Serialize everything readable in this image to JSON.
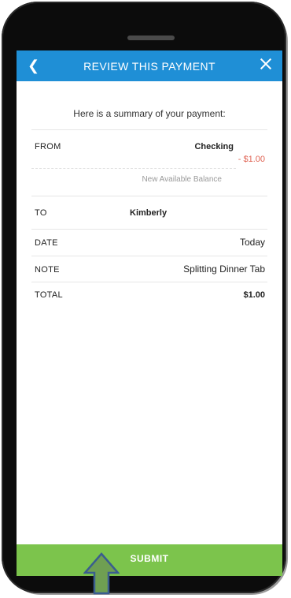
{
  "header": {
    "back_icon": "chevron-left-icon",
    "title": "REVIEW THIS PAYMENT",
    "close_icon": "close-icon"
  },
  "summary_text": "Here is a summary of your payment:",
  "rows": {
    "from": {
      "label": "FROM",
      "account": "Checking",
      "amount": "- $1.00",
      "balance_label": "New Available Balance"
    },
    "to": {
      "label": "TO",
      "value": "Kimberly"
    },
    "date": {
      "label": "DATE",
      "value": "Today"
    },
    "note": {
      "label": "NOTE",
      "value": "Splitting Dinner Tab"
    },
    "total": {
      "label": "TOTAL",
      "value": "$1.00"
    }
  },
  "submit_label": "SUBMIT",
  "colors": {
    "header": "#1f8fd6",
    "submit": "#7cc44c",
    "negative_amount": "#e06454",
    "arrow_fill": "#6f9f52",
    "arrow_stroke": "#3a5d8f"
  }
}
